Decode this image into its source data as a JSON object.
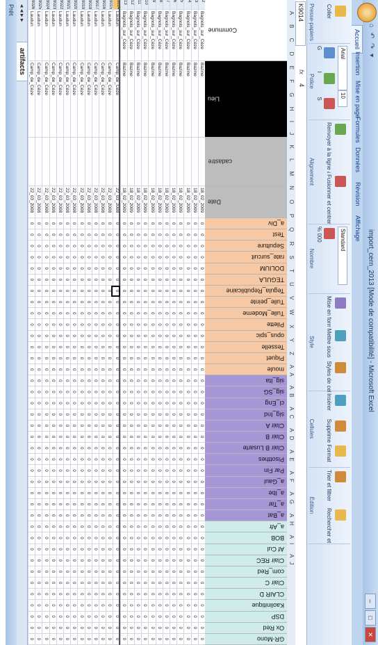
{
  "window": {
    "title": "import_cern_2013 [Mode de compatibilité] - Microsoft Excel",
    "quick_access": "⌂ ↶ ↷ ▾"
  },
  "tabs": [
    "Accueil",
    "Insertion",
    "Mise en page",
    "Formules",
    "Données",
    "Révision",
    "Affichage"
  ],
  "ribbon": {
    "groups": [
      {
        "label": "Presse-papiers",
        "buttons": [
          "Coller"
        ]
      },
      {
        "label": "Police",
        "font": "Arial",
        "size": "10",
        "buttons": [
          "G",
          "I",
          "S"
        ]
      },
      {
        "label": "Alignement",
        "buttons": [
          "Renvoyer à la ligne automatiquement",
          "Fusionner et centrer"
        ]
      },
      {
        "label": "Nombre",
        "format": "Standard",
        "buttons": [
          "% 000"
        ]
      },
      {
        "label": "Style",
        "buttons": [
          "Mise en forme conditionnelle",
          "Mettre sous forme de tableau",
          "Styles de cellules"
        ]
      },
      {
        "label": "Cellules",
        "buttons": [
          "Insérer",
          "Supprimer",
          "Format"
        ]
      },
      {
        "label": "Édition",
        "buttons": [
          "Trier et filtrer",
          "Rechercher et sélectionner"
        ]
      }
    ]
  },
  "formula_bar": {
    "name_box": "K9014",
    "fx": "fx",
    "value": "4"
  },
  "columns_header": "A B C D E F G H I J K L M N O P Q R S T U V W X Y Z AA AB AC AD AE AF AG AH AI AJ",
  "left_headers": {
    "commune": "Commune",
    "lieu": "Lieu",
    "cadastre": "cadastre",
    "date": "Date"
  },
  "field_headers": [
    {
      "label": "a_Div",
      "color": "#f6c9a4"
    },
    {
      "label": "Test",
      "color": "#f6c9a4"
    },
    {
      "label": "Sepulture",
      "color": "#f6c9a4"
    },
    {
      "label": "rate_surcuit",
      "color": "#f6c9a4"
    },
    {
      "label": "DOLIUM",
      "color": "#f6c9a4"
    },
    {
      "label": "TEGULA",
      "color": "#f6c9a4"
    },
    {
      "label": "Tegula_Republicaine",
      "color": "#f6c9a4"
    },
    {
      "label": "Tuile_peinte",
      "color": "#f6c9a4"
    },
    {
      "label": "Tuile_Moderne",
      "color": "#f6c9a4"
    },
    {
      "label": "Pilette",
      "color": "#f6c9a4"
    },
    {
      "label": "opus_spic",
      "color": "#f6c9a4"
    },
    {
      "label": "Tesselle",
      "color": "#f6c9a4"
    },
    {
      "label": "Piquet",
      "color": "#f6c9a4"
    },
    {
      "label": "moule",
      "color": "#f6c9a4"
    },
    {
      "label": "sig_Ita",
      "color": "#a796d6"
    },
    {
      "label": "sig_SG",
      "color": "#a796d6"
    },
    {
      "label": "cl_Eng",
      "color": "#a796d6"
    },
    {
      "label": "sig_Ind",
      "color": "#a796d6"
    },
    {
      "label": "Clair A",
      "color": "#a796d6"
    },
    {
      "label": "Clair B",
      "color": "#a796d6"
    },
    {
      "label": "Clair B Lusarte",
      "color": "#a796d6"
    },
    {
      "label": "Pisotthes",
      "color": "#a796d6"
    },
    {
      "label": "Par Fin",
      "color": "#a796d6"
    },
    {
      "label": "a_Gaul",
      "color": "#a796d6"
    },
    {
      "label": "a_Ibe",
      "color": "#a796d6"
    },
    {
      "label": "a_Tar",
      "color": "#a796d6"
    },
    {
      "label": "a_Bat",
      "color": "#a796d6"
    },
    {
      "label": "a_Afr",
      "color": "#cfeceb"
    },
    {
      "label": "BOB",
      "color": "#cfeceb"
    },
    {
      "label": "Af Cul",
      "color": "#cfeceb"
    },
    {
      "label": "Clair REC",
      "color": "#cfeceb"
    },
    {
      "label": "com_Red",
      "color": "#cfeceb"
    },
    {
      "label": "Clair C",
      "color": "#cfeceb"
    },
    {
      "label": "CLAIR D",
      "color": "#cfeceb"
    },
    {
      "label": "Kaolinitique",
      "color": "#cfeceb"
    },
    {
      "label": "DSP",
      "color": "#cfeceb"
    },
    {
      "label": "Ox Red",
      "color": "#cfeceb"
    },
    {
      "label": "GR-Mono",
      "color": "#cfeceb"
    }
  ],
  "rows": [
    {
      "n": "2",
      "commune": "Bagnols_sur_Cèze",
      "lieu": "Bazine",
      "date": "18_02_2009"
    },
    {
      "n": "3",
      "commune": "Bagnols_sur_Cèze",
      "lieu": "Bazine",
      "date": "18_02_2009"
    },
    {
      "n": "4",
      "commune": "Bagnols_sur_Cèze",
      "lieu": "Bazine",
      "date": "18_02_2009"
    },
    {
      "n": "5",
      "commune": "Bagnols_sur_Cèze",
      "lieu": "Bazine",
      "date": "18_02_2009"
    },
    {
      "n": "6",
      "commune": "Bagnols_sur_Cèze",
      "lieu": "Bazine",
      "date": "18_02_2009"
    },
    {
      "n": "7",
      "commune": "Bagnols_sur_Cèze",
      "lieu": "Bazine",
      "date": "18_02_2009"
    },
    {
      "n": "8",
      "commune": "Bagnols_sur_Cèze",
      "lieu": "Bazine",
      "date": "18_02_2009"
    },
    {
      "n": "9",
      "commune": "Bagnols_sur_Cèze",
      "lieu": "Bazine",
      "date": "18_02_2009"
    },
    {
      "n": "10",
      "commune": "Bagnols_sur_Cèze",
      "lieu": "Bazine",
      "date": "18_02_2009"
    },
    {
      "n": "11",
      "commune": "Bagnols_sur_Cèze",
      "lieu": "Bazine",
      "date": "18_02_2009"
    },
    {
      "n": "12",
      "commune": "Bagnols_sur_Cèze",
      "lieu": "Bazine",
      "date": "18_02_2009"
    },
    {
      "n": "13",
      "commune": "Bagnols_sur_Cèze",
      "lieu": "Bazine",
      "date": "18_02_2009"
    },
    {
      "n": "9014",
      "commune": "Laudun",
      "lieu": "Camp_de_Cèze",
      "date": "22_03_2008"
    },
    {
      "n": "9015",
      "commune": "Laudun",
      "lieu": "Camp_de_Cèze",
      "date": "22_03_2008"
    },
    {
      "n": "9016",
      "commune": "Laudun",
      "lieu": "Camp_de_Cèze",
      "date": "22_03_2008"
    },
    {
      "n": "9017",
      "commune": "Laudun",
      "lieu": "Camp_de_Cèze",
      "date": "22_03_2008"
    },
    {
      "n": "9018",
      "commune": "Laudun",
      "lieu": "Camp_de_Cèze",
      "date": "22_03_2008"
    },
    {
      "n": "9019",
      "commune": "Laudun",
      "lieu": "Camp_de_Cèze",
      "date": "22_03_2008"
    },
    {
      "n": "9020",
      "commune": "Laudun",
      "lieu": "Camp_de_Cèze",
      "date": "22_03_2008"
    },
    {
      "n": "9021",
      "commune": "Laudun",
      "lieu": "Camp_de_Cèze",
      "date": "22_03_2008"
    },
    {
      "n": "9022",
      "commune": "Laudun",
      "lieu": "Camp_de_Cèze",
      "date": "22_03_2008"
    },
    {
      "n": "9023",
      "commune": "Laudun",
      "lieu": "Camp_de_Cèze",
      "date": "22_03_2008"
    },
    {
      "n": "9024",
      "commune": "Laudun",
      "lieu": "Camp_de_Cèze",
      "date": "22_03_2008"
    },
    {
      "n": "9025",
      "commune": "Laudun",
      "lieu": "Camp_de_Cèze",
      "date": "22_03_2008"
    },
    {
      "n": "9026",
      "commune": "Laudun",
      "lieu": "Camp_de_Cèze",
      "date": "22_03_2008"
    }
  ],
  "cell_value_top": "0",
  "cell_value_bottom": "0",
  "sheet_tab": "artifacts",
  "status": "Prêt",
  "colors": {
    "ribbon": "#d5e3f5",
    "black_header": "#000000",
    "gray_header": "#bdbdbd",
    "salmon": "#f6c9a4",
    "lavender": "#a796d6",
    "mint": "#cfeceb"
  }
}
